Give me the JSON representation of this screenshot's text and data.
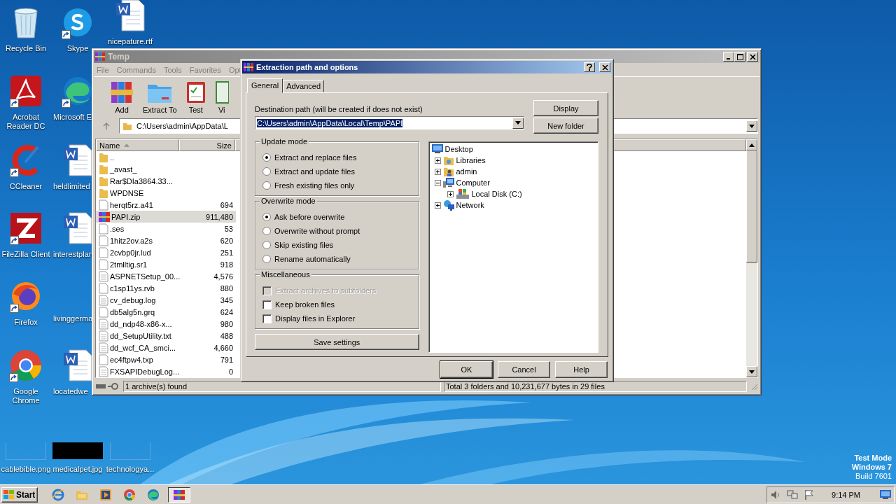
{
  "desktop_icons": [
    {
      "label": "Recycle Bin",
      "shortcut": false
    },
    {
      "label": "Acrobat Reader DC",
      "shortcut": true
    },
    {
      "label": "CCleaner",
      "shortcut": true
    },
    {
      "label": "FileZilla Client",
      "shortcut": true
    },
    {
      "label": "Firefox",
      "shortcut": true
    },
    {
      "label": "Google Chrome",
      "shortcut": true
    },
    {
      "label": "cablebible.png",
      "shortcut": false
    },
    {
      "label": "Skype",
      "shortcut": true
    },
    {
      "label": "Microsoft E",
      "shortcut": true
    },
    {
      "label": "heldlimited",
      "shortcut": false
    },
    {
      "label": "interestplan",
      "shortcut": false
    },
    {
      "label": "livinggerma",
      "shortcut": false
    },
    {
      "label": "locatedwe",
      "shortcut": false
    },
    {
      "label": "medicalpet.jpg",
      "shortcut": false
    },
    {
      "label": "nicepature.rtf",
      "shortcut": false
    },
    {
      "label": "technologya...",
      "shortcut": false
    }
  ],
  "main_window": {
    "title": "Temp",
    "menu": [
      "File",
      "Commands",
      "Tools",
      "Favorites",
      "Opt"
    ],
    "toolbar": [
      "Add",
      "Extract To",
      "Test",
      "Vi"
    ],
    "address": "C:\\Users\\admin\\AppData\\L",
    "columns": [
      "Name",
      "Size"
    ],
    "rows": [
      {
        "name": "..",
        "size": "",
        "kind": "folder",
        "selected": false
      },
      {
        "name": "_avast_",
        "size": "",
        "kind": "folder",
        "selected": false
      },
      {
        "name": "Rar$DIa3864.33...",
        "size": "",
        "kind": "folder",
        "selected": false
      },
      {
        "name": "WPDNSE",
        "size": "",
        "kind": "folder",
        "selected": false
      },
      {
        "name": "herqt5rz.a41",
        "size": "694",
        "kind": "file",
        "selected": false
      },
      {
        "name": "PAPI.zip",
        "size": "911,480",
        "kind": "archive",
        "selected": true
      },
      {
        "name": ".ses",
        "size": "53",
        "kind": "file",
        "selected": false
      },
      {
        "name": "1hitz2ov.a2s",
        "size": "620",
        "kind": "file",
        "selected": false
      },
      {
        "name": "2cvbp0jr.lud",
        "size": "251",
        "kind": "file",
        "selected": false
      },
      {
        "name": "2tmlltig.sr1",
        "size": "918",
        "kind": "file",
        "selected": false
      },
      {
        "name": "ASPNETSetup_00...",
        "size": "4,576",
        "kind": "text",
        "selected": false
      },
      {
        "name": "c1sp11ys.rvb",
        "size": "880",
        "kind": "file",
        "selected": false
      },
      {
        "name": "cv_debug.log",
        "size": "345",
        "kind": "text",
        "selected": false
      },
      {
        "name": "db5alg5n.grq",
        "size": "624",
        "kind": "file",
        "selected": false
      },
      {
        "name": "dd_ndp48-x86-x...",
        "size": "980",
        "kind": "text",
        "selected": false
      },
      {
        "name": "dd_SetupUtility.txt",
        "size": "488",
        "kind": "text",
        "selected": false
      },
      {
        "name": "dd_wcf_CA_smci...",
        "size": "4,660",
        "kind": "text",
        "selected": false
      },
      {
        "name": "ec4ftpw4.txp",
        "size": "791",
        "kind": "file",
        "selected": false
      },
      {
        "name": "FXSAPIDebugLog...",
        "size": "0",
        "kind": "text",
        "selected": false
      }
    ],
    "status_left": "1 archive(s) found",
    "status_right": "Total 3 folders and 10,231,677 bytes in 29 files"
  },
  "dialog": {
    "title": "Extraction path and options",
    "tabs": [
      {
        "label": "General",
        "selected": true
      },
      {
        "label": "Advanced",
        "selected": false
      }
    ],
    "destination_label": "Destination path (will be created if does not exist)",
    "destination_value": "C:\\Users\\admin\\AppData\\Local\\Temp\\PAPI",
    "side_buttons": [
      "Display",
      "New folder"
    ],
    "groups": [
      {
        "title": "Update mode",
        "items": [
          {
            "kind": "radio",
            "label": "Extract and replace files",
            "checked": true,
            "disabled": false
          },
          {
            "kind": "radio",
            "label": "Extract and update files",
            "checked": false,
            "disabled": false
          },
          {
            "kind": "radio",
            "label": "Fresh existing files only",
            "checked": false,
            "disabled": false
          }
        ]
      },
      {
        "title": "Overwrite mode",
        "items": [
          {
            "kind": "radio",
            "label": "Ask before overwrite",
            "checked": true,
            "disabled": false
          },
          {
            "kind": "radio",
            "label": "Overwrite without prompt",
            "checked": false,
            "disabled": false
          },
          {
            "kind": "radio",
            "label": "Skip existing files",
            "checked": false,
            "disabled": false
          },
          {
            "kind": "radio",
            "label": "Rename automatically",
            "checked": false,
            "disabled": false
          }
        ]
      },
      {
        "title": "Miscellaneous",
        "items": [
          {
            "kind": "checkbox",
            "label": "Extract archives to subfolders",
            "checked": false,
            "disabled": true
          },
          {
            "kind": "checkbox",
            "label": "Keep broken files",
            "checked": false,
            "disabled": false
          },
          {
            "kind": "checkbox",
            "label": "Display files in Explorer",
            "checked": false,
            "disabled": false
          }
        ]
      }
    ],
    "save_button": "Save settings",
    "tree": {
      "label": "Desktop",
      "children": [
        {
          "label": "Libraries",
          "expanded": false
        },
        {
          "label": "admin",
          "expanded": false
        },
        {
          "label": "Computer",
          "expanded": true,
          "children": [
            {
              "label": "Local Disk (C:)",
              "expanded": false
            }
          ]
        },
        {
          "label": "Network",
          "expanded": false
        }
      ]
    },
    "buttons": [
      "OK",
      "Cancel",
      "Help"
    ]
  },
  "taskbar": {
    "start": "Start",
    "apps": [
      {
        "selected": false
      },
      {
        "selected": false
      },
      {
        "selected": false
      },
      {
        "selected": false
      },
      {
        "selected": false
      },
      {
        "selected": true
      }
    ],
    "clock": "9:14 PM"
  },
  "os_notice": [
    "Test Mode",
    "Windows 7",
    "Build 7601"
  ]
}
